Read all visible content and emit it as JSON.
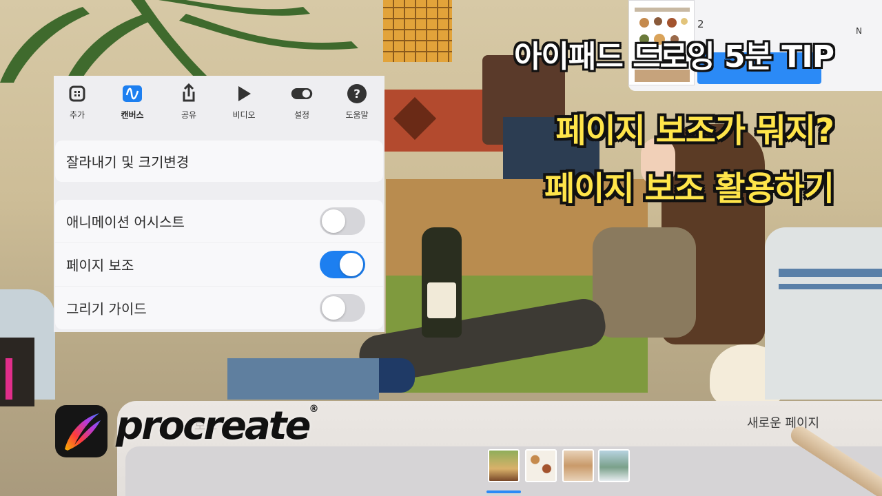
{
  "video_title": {
    "line1": "아이패드 드로잉 5분 TIP",
    "line2": "페이지 보조가 뭐지?",
    "line3": "페이지 보조 활용하기"
  },
  "settings_popover": {
    "tabs": [
      {
        "label": "추가",
        "icon": "add-icon"
      },
      {
        "label": "캔버스",
        "icon": "canvas-icon",
        "active": true
      },
      {
        "label": "공유",
        "icon": "share-icon"
      },
      {
        "label": "비디오",
        "icon": "video-icon"
      },
      {
        "label": "설정",
        "icon": "settings-toggle-icon"
      },
      {
        "label": "도움말",
        "icon": "help-icon"
      }
    ],
    "crop_resize": "잘라내기 및 크기변경",
    "toggles": [
      {
        "label": "애니메이션 어시스트",
        "on": false
      },
      {
        "label": "페이지 보조",
        "on": true
      },
      {
        "label": "그리기 가이드",
        "on": false
      }
    ]
  },
  "thumbnail_panel": {
    "page_number": "2",
    "corner_letter": "N"
  },
  "page_assist_bar": {
    "new_page": "새로운 페이지",
    "faded_label": "보조",
    "thumbnail_count": 4,
    "selected_index": 0
  },
  "brand": {
    "name": "procreate",
    "registered": "®"
  },
  "colors": {
    "accent_blue": "#1d7ff0",
    "title_yellow": "#ffe54a",
    "title_white": "#ffffff"
  }
}
